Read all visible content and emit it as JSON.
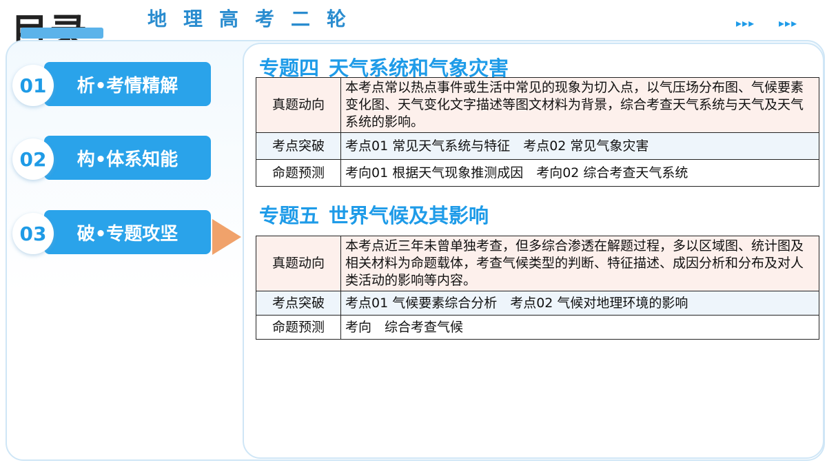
{
  "header": {
    "title": "目录",
    "subtitle": "地理高考二轮",
    "arrows_1": "▸▸▸",
    "arrows_2": "▸▸▸"
  },
  "nav": [
    {
      "num": "01",
      "label": "析•考情精解",
      "active": false
    },
    {
      "num": "02",
      "label": "构•体系知能",
      "active": false
    },
    {
      "num": "03",
      "label": "破•专题攻坚",
      "active": true
    }
  ],
  "topics": [
    {
      "code": "专题四",
      "name": "天气系统和气象灾害",
      "rows": [
        {
          "label": "真题动向",
          "text": "本考点常以热点事件或生活中常见的现象为切入点，以气压场分布图、气候要素变化图、天气变化文字描述等图文材料为背景，综合考查天气系统与天气及天气系统的影响。"
        },
        {
          "label": "考点突破",
          "text": "考点01 常见天气系统与特征　考点02 常见气象灾害"
        },
        {
          "label": "命题预测",
          "text": "考向01 根据天气现象推测成因　考向02 综合考查天气系统"
        }
      ]
    },
    {
      "code": "专题五",
      "name": "世界气候及其影响",
      "rows": [
        {
          "label": "真题动向",
          "text": "本考点近三年未曾单独考查，但多综合渗透在解题过程，多以区域图、统计图及相关材料为命题载体，考查气候类型的判断、特征描述、成因分析和分布及对人类活动的影响等内容。"
        },
        {
          "label": "考点突破",
          "text": "考点01 气候要素综合分析　考点02 气候对地理环境的影响"
        },
        {
          "label": "命题预测",
          "text": "考向　综合考查气候"
        }
      ]
    }
  ],
  "colors": {
    "accent": "#2aa3ea",
    "number": "#1f9be6",
    "pointer": "#f0a26b",
    "row_pink": "#fdf0ec",
    "row_blue": "#eef5fb"
  }
}
